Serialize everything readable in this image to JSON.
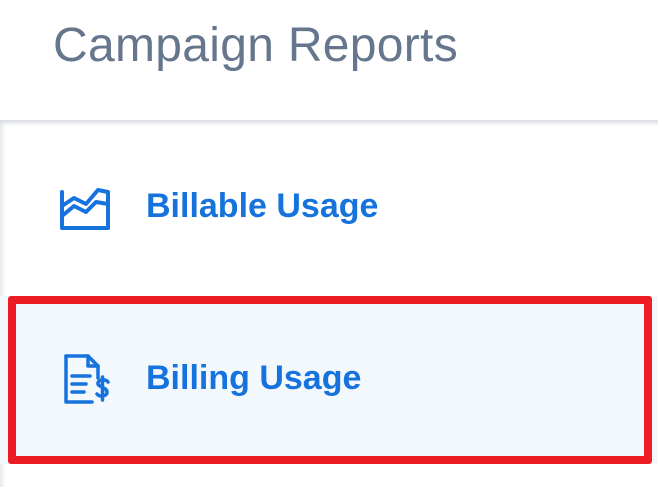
{
  "panel": {
    "title": "Campaign Reports"
  },
  "menu": {
    "items": [
      {
        "label": "Billable Usage",
        "icon": "area-chart-icon",
        "active": false
      },
      {
        "label": "Billing Usage",
        "icon": "invoice-dollar-icon",
        "active": true
      }
    ]
  },
  "colors": {
    "title": "#66768c",
    "link": "#1673dd",
    "active_bg": "#f2f8fc",
    "highlight": "#ee1c25"
  }
}
